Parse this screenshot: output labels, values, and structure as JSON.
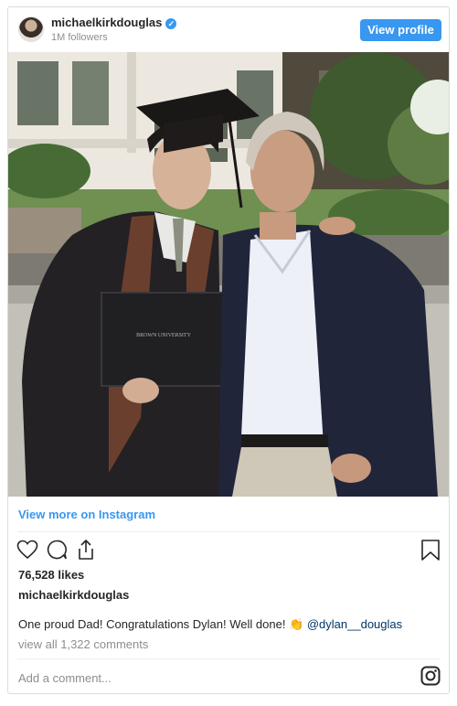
{
  "header": {
    "username": "michaelkirkdouglas",
    "followers": "1M followers",
    "view_profile_label": "View profile"
  },
  "photo": {
    "diploma_text": "BROWN UNIVERSITY"
  },
  "view_more_label": "View more on Instagram",
  "likes": "76,528 likes",
  "owner": "michaelkirkdouglas",
  "caption": {
    "text": "One proud Dad! Congratulations Dylan! Well done! 👏",
    "mention": "@dylan__douglas"
  },
  "view_all_comments": "view all 1,322 comments",
  "comment_placeholder": "Add a comment...",
  "colors": {
    "accent": "#3897f0",
    "text": "#262626",
    "muted": "#8e8e8e"
  },
  "icons": [
    "heart-icon",
    "comment-icon",
    "share-icon",
    "bookmark-icon",
    "instagram-icon",
    "verified-icon"
  ]
}
